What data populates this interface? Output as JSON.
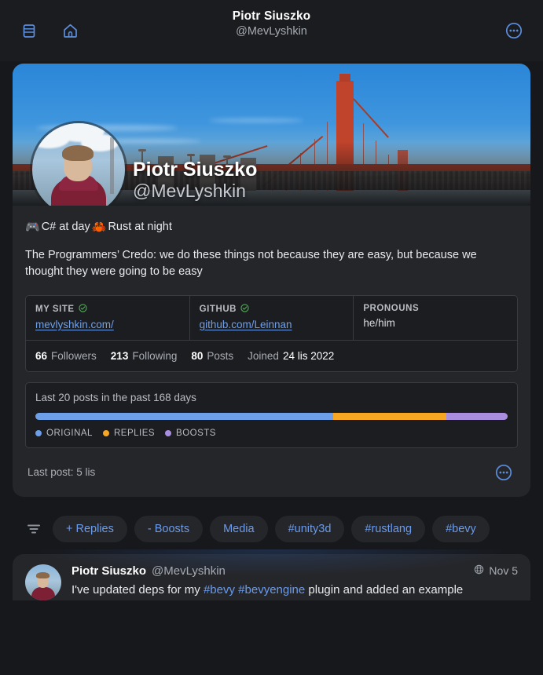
{
  "topbar": {
    "icons": [
      {
        "name": "columns-icon",
        "label": "Columns"
      },
      {
        "name": "home-icon",
        "label": "Home"
      }
    ],
    "title": "Piotr Siuszko",
    "handle": "@MevLyshkin",
    "menu_icon": "ellipsis-circle-icon"
  },
  "profile": {
    "display_name": "Piotr Siuszko",
    "handle": "@MevLyshkin",
    "banner_alt": "Golden Gate Bridge",
    "avatar_alt": "Piotr Siuszko avatar",
    "bio_emoji_left": "🎮",
    "bio_text_1": "C# at day",
    "bio_emoji_right": "🦀",
    "bio_text_2": "Rust at night",
    "credo": "The Programmers’ Credo: we do these things not because they are easy, but because we thought they were going to be easy",
    "fields": [
      {
        "label": "MY SITE",
        "verified": true,
        "link_text": "mevlyshkin.com/",
        "is_link": true
      },
      {
        "label": "GITHUB",
        "verified": true,
        "link_text": "github.com/Leinnan",
        "link_prefix": "github.com/",
        "link_suffix": "Leinnan",
        "is_link": true
      },
      {
        "label": "PRONOUNS",
        "verified": false,
        "link_text": "he/him",
        "is_link": false
      }
    ],
    "stats": [
      {
        "value": "66",
        "label": "Followers"
      },
      {
        "value": "213",
        "label": "Following"
      },
      {
        "value": "80",
        "label": "Posts"
      }
    ],
    "joined_label": "Joined",
    "joined_value": "24 lis 2022",
    "last_post_label": "Last post: 5 lis",
    "more_icon": "ellipsis-circle-icon"
  },
  "activity": {
    "title": "Last 20 posts in the past 168 days",
    "segments": [
      {
        "label": "ORIGINAL",
        "color": "#6d9ee8",
        "percent": 63
      },
      {
        "label": "REPLIES",
        "color": "#f5a623",
        "percent": 24
      },
      {
        "label": "BOOSTS",
        "color": "#a98ee0",
        "percent": 13
      }
    ]
  },
  "filters": {
    "filter_icon": "filter-icon",
    "chips": [
      {
        "sign": "+",
        "label": "Replies"
      },
      {
        "sign": "-",
        "label": "Boosts"
      },
      {
        "sign": "",
        "label": "Media"
      },
      {
        "sign": "",
        "label": "#unity3d"
      },
      {
        "sign": "",
        "label": "#rustlang"
      },
      {
        "sign": "",
        "label": "#bevy"
      }
    ]
  },
  "post": {
    "author_name": "Piotr Siuszko",
    "author_handle": "@MevLyshkin",
    "visibility_icon": "globe-icon",
    "date": "Nov 5",
    "text_before": "I've updated deps for my ",
    "tag1": "#bevy",
    "text_mid": " ",
    "tag2": "#bevyengine",
    "text_after": " plugin and added an example"
  }
}
